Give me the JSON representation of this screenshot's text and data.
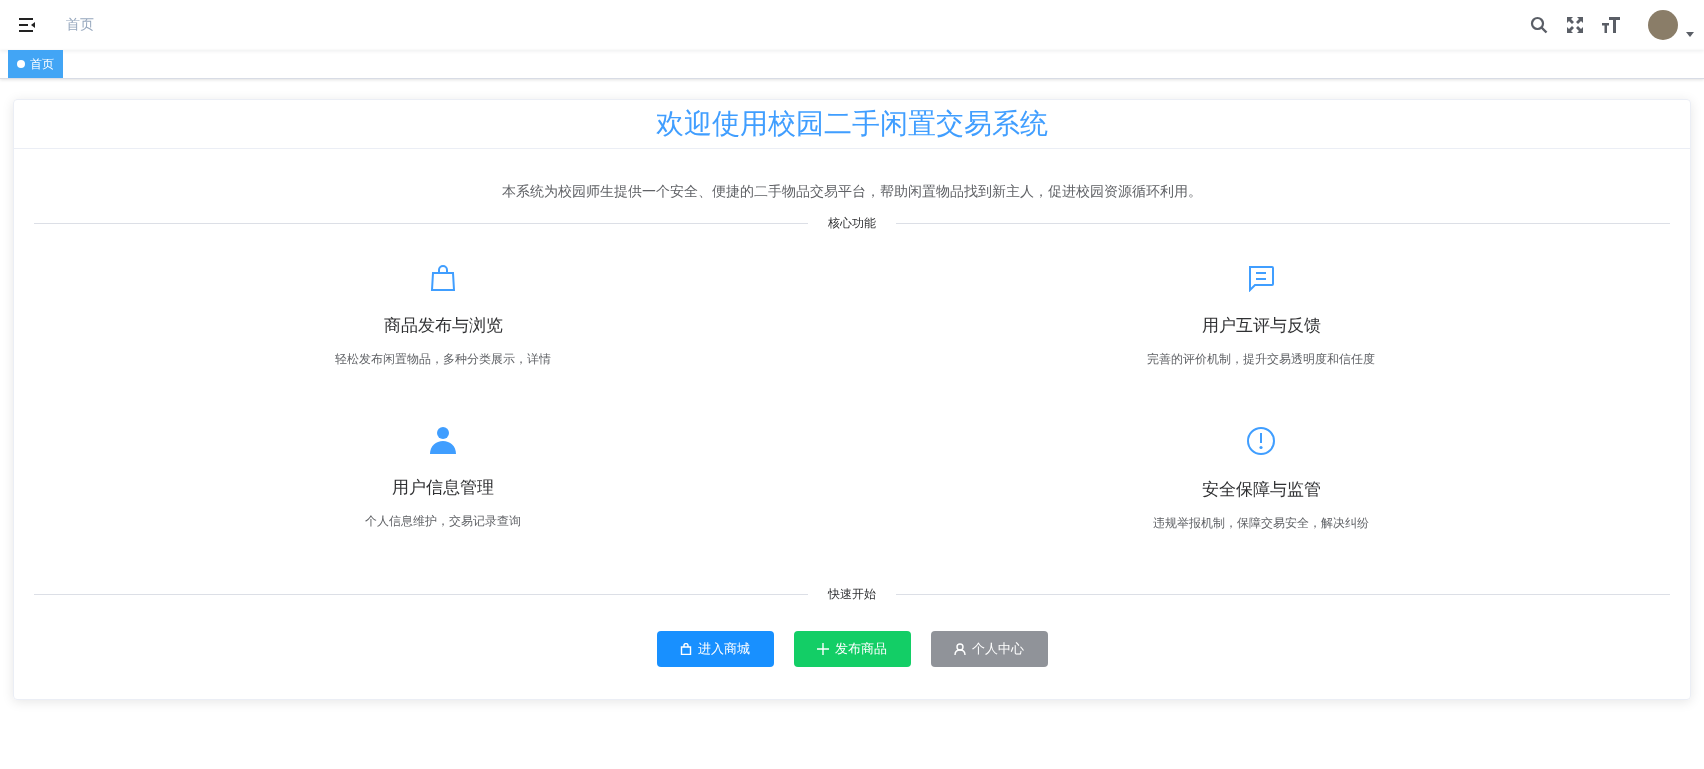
{
  "navbar": {
    "breadcrumb": "首页"
  },
  "tags": [
    {
      "label": "首页",
      "selected": true
    }
  ],
  "card": {
    "title": "欢迎使用校园二手闲置交易系统",
    "description": "本系统为校园师生提供一个安全、便捷的二手物品交易平台，帮助闲置物品找到新主人，促进校园资源循环利用。",
    "features_heading": "核心功能",
    "features": [
      {
        "kind": "bag",
        "title": "商品发布与浏览",
        "text": "轻松发布闲置物品，多种分类展示，详情"
      },
      {
        "kind": "chat",
        "title": "用户互评与反馈",
        "text": "完善的评价机制，提升交易透明度和信任度"
      },
      {
        "kind": "user",
        "title": "用户信息管理",
        "text": "个人信息维护，交易记录查询"
      },
      {
        "kind": "warning",
        "title": "安全保障与监管",
        "text": "违规举报机制，保障交易安全，解决纠纷"
      }
    ],
    "quick_heading": "快速开始",
    "buttons": [
      {
        "kind": "primary",
        "label": "进入商城"
      },
      {
        "kind": "success",
        "label": "发布商品"
      },
      {
        "kind": "info",
        "label": "个人中心"
      }
    ]
  }
}
